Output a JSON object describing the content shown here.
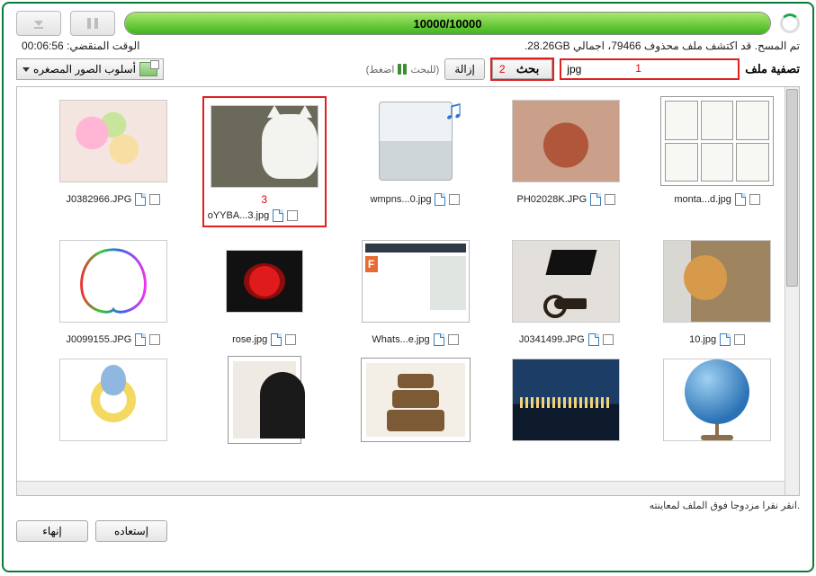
{
  "progress": {
    "text": "10000/10000"
  },
  "time": {
    "label": "الوقت المنقضي:",
    "value": "00:06:56"
  },
  "scan": {
    "summary": "تم المسح. قد اكتشف ملف محذوف 79466، اجمالي 28.26GB."
  },
  "filter": {
    "label": "تصفية ملف",
    "value": "jpg",
    "search": "بحث",
    "remove": "إزالة",
    "hint": "(اضغط || للبحث)",
    "view": "أسلوب الصور المصغره"
  },
  "annotations": {
    "one": "1",
    "two": "2",
    "three": "3"
  },
  "items": [
    {
      "name": "monta...d.jpg"
    },
    {
      "name": "PH02028K.JPG"
    },
    {
      "name": "wmpns...0.jpg"
    },
    {
      "name": "oYYBA...3.jpg"
    },
    {
      "name": "J0382966.JPG"
    },
    {
      "name": "10.jpg"
    },
    {
      "name": "J0341499.JPG"
    },
    {
      "name": "Whats...e.jpg"
    },
    {
      "name": "rose.jpg"
    },
    {
      "name": "J0099155.JPG"
    }
  ],
  "footer": {
    "hint": "انقر نقرا مزدوجا فوق الملف لمعاينته.",
    "recover": "إستعاده",
    "finish": "إنهاء"
  }
}
